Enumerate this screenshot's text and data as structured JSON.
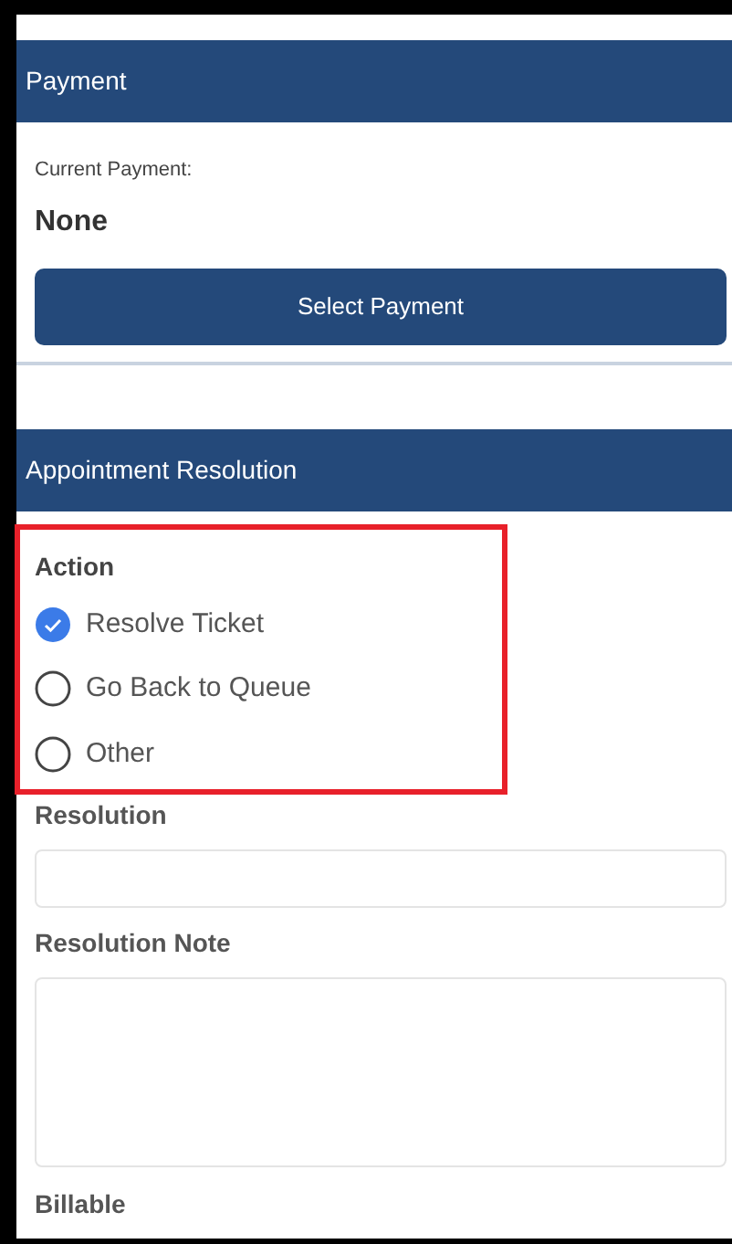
{
  "payment": {
    "title": "Payment",
    "current_label": "Current Payment:",
    "current_value": "None",
    "button": "Select Payment"
  },
  "resolution": {
    "title": "Appointment Resolution",
    "action": {
      "label": "Action",
      "highlighted": true,
      "options": [
        {
          "label": "Resolve Ticket",
          "selected": true
        },
        {
          "label": "Go Back to Queue",
          "selected": false
        },
        {
          "label": "Other",
          "selected": false
        }
      ]
    },
    "resolution_field": {
      "label": "Resolution"
    },
    "note_field": {
      "label": "Resolution Note"
    },
    "billable": {
      "label": "Billable"
    }
  }
}
